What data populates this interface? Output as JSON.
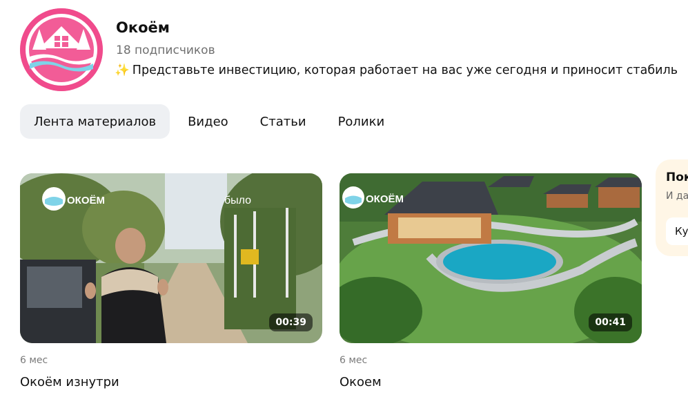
{
  "channel": {
    "name": "Окоём",
    "subscribers": "18 подписчиков",
    "description": "Представьте инвестицию, которая работает на вас уже сегодня и приносит стабиль"
  },
  "tabs": [
    {
      "label": "Лента материалов",
      "active": true
    },
    {
      "label": "Видео",
      "active": false
    },
    {
      "label": "Статьи",
      "active": false
    },
    {
      "label": "Ролики",
      "active": false
    }
  ],
  "videos": [
    {
      "duration": "00:39",
      "age": "6 мес",
      "title": "Окоём изнутри",
      "watermark": "ОКОЁМ",
      "overlay_text": "было"
    },
    {
      "duration": "00:41",
      "age": "6 мес",
      "title": "Окоем",
      "watermark": "ОКОЁМ"
    }
  ],
  "promo": {
    "title": "Пок",
    "text": "И да",
    "button": "Ку"
  },
  "colors": {
    "brand_pink": "#f04b8c",
    "tab_active_bg": "#eef0f3",
    "promo_bg": "#fff6e6"
  }
}
